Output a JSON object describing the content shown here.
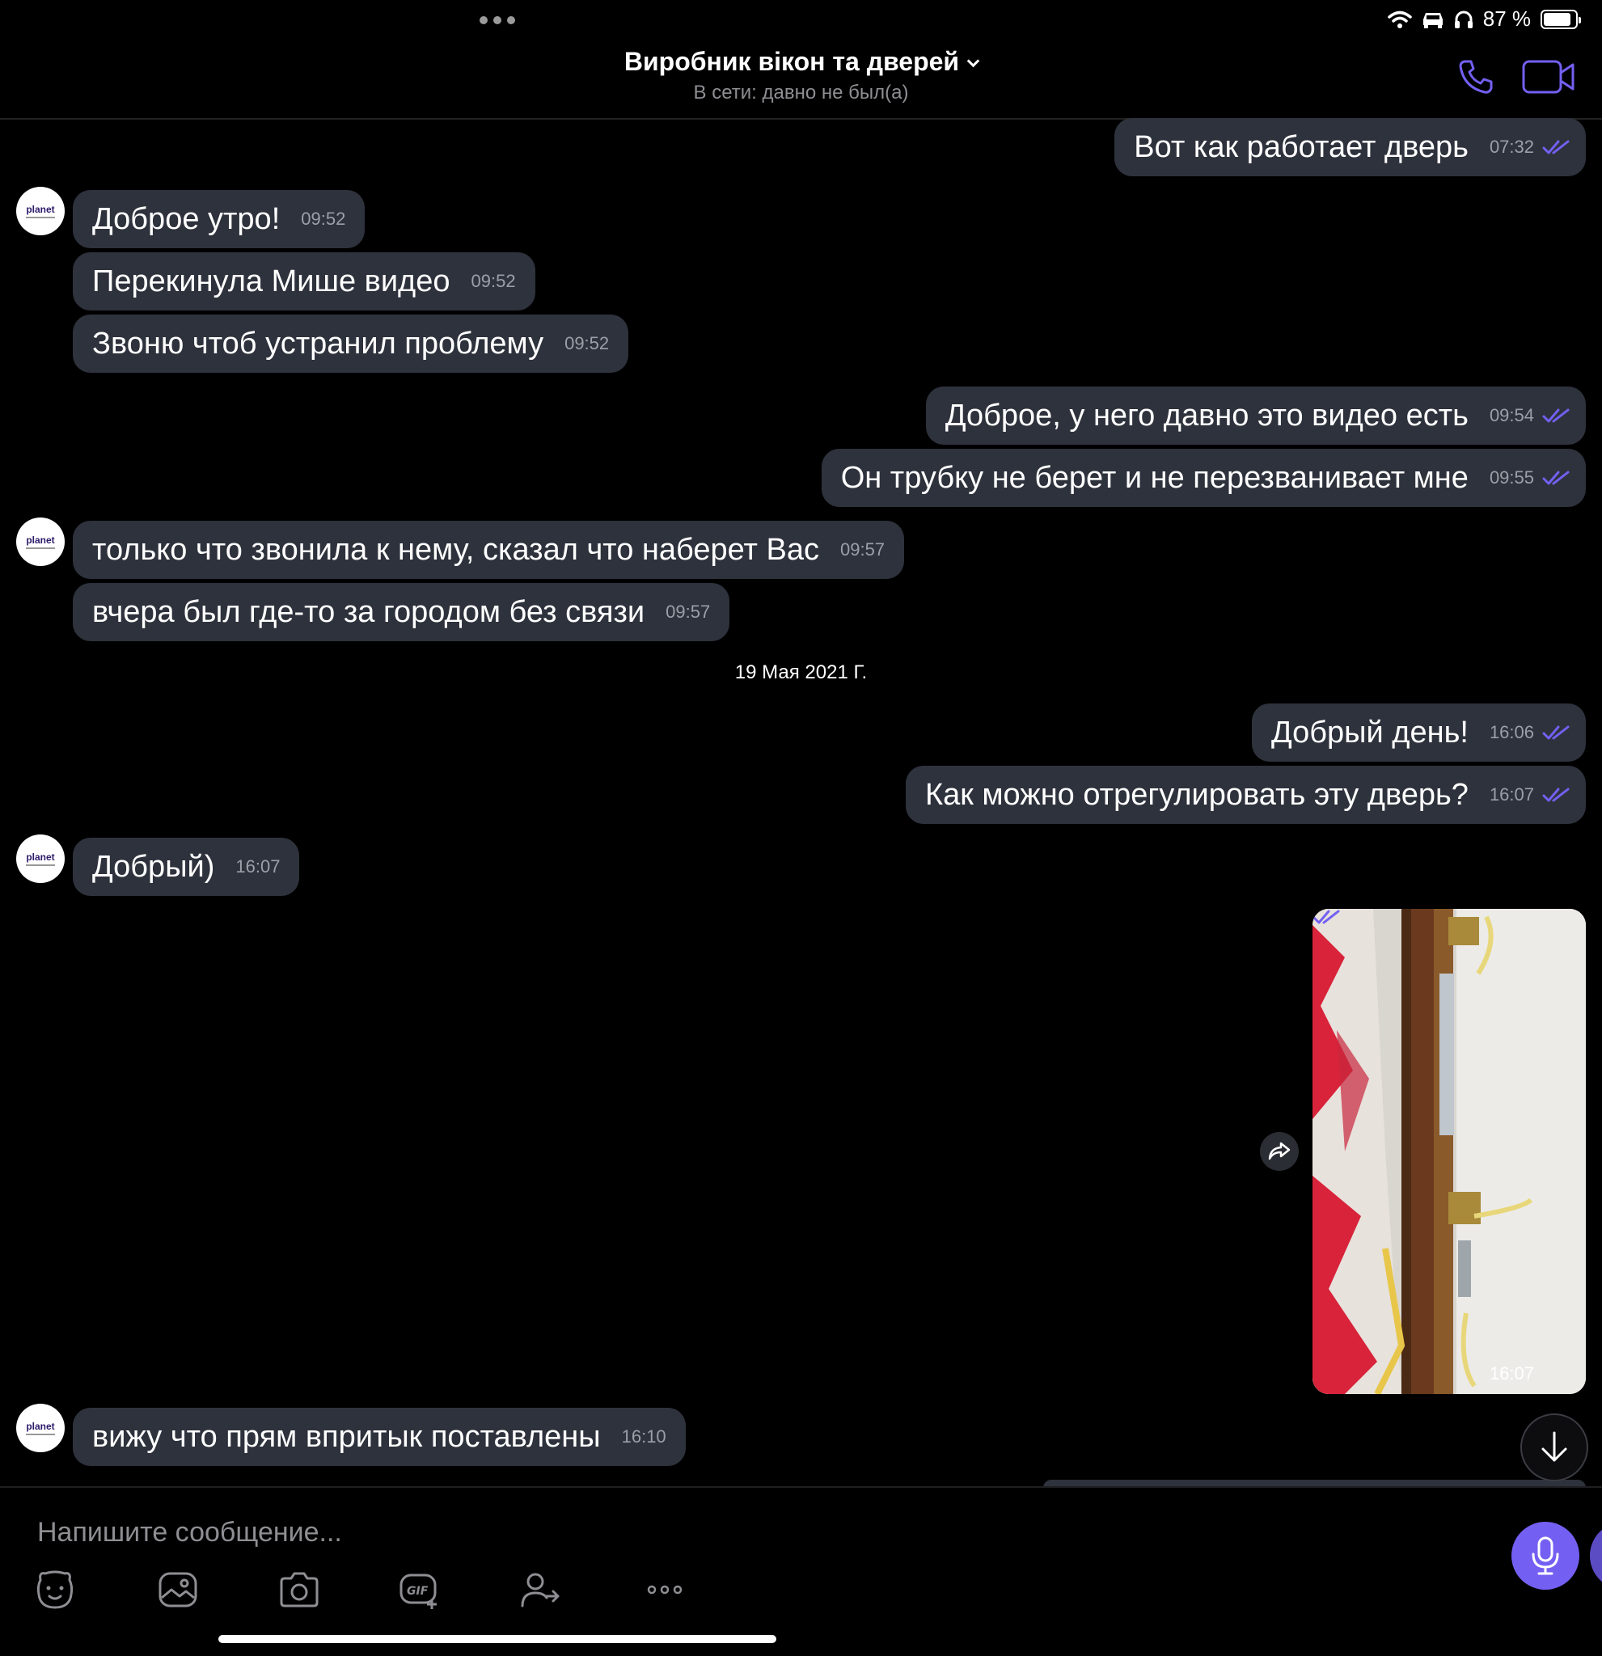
{
  "status": {
    "battery": "87 %",
    "battery_level": 0.87
  },
  "header": {
    "title": "Виробник вікон та дверей",
    "subtitle": "В сети: давно не был(а)"
  },
  "avatar": {
    "label": "planet"
  },
  "messages": [
    {
      "text": "Вот как работает дверь",
      "time": "07:32",
      "dir": "out"
    },
    {
      "text": "Доброе утро!",
      "time": "09:52",
      "dir": "in"
    },
    {
      "text": "Перекинула Мише видео",
      "time": "09:52",
      "dir": "in"
    },
    {
      "text": "Звоню чтоб устранил проблему",
      "time": "09:52",
      "dir": "in"
    },
    {
      "text": "Доброе, у него давно это видео есть",
      "time": "09:54",
      "dir": "out"
    },
    {
      "text": "Он трубку не берет и не перезванивает мне",
      "time": "09:55",
      "dir": "out"
    },
    {
      "text": "только что звонила к нему, сказал что наберет Вас",
      "time": "09:57",
      "dir": "in"
    },
    {
      "text": "вчера был где-то за городом без связи",
      "time": "09:57",
      "dir": "in"
    },
    {
      "text": "Добрый день!",
      "time": "16:06",
      "dir": "out"
    },
    {
      "text": "Как можно отрегулировать эту дверь?",
      "time": "16:07",
      "dir": "out"
    },
    {
      "text": "Добрый)",
      "time": "16:07",
      "dir": "in"
    },
    {
      "text": "вижу что прям впритык поставлены",
      "time": "16:10",
      "dir": "in"
    }
  ],
  "date_separator": "19 Мая 2021 Г.",
  "video_message": {
    "time": "16:07"
  },
  "composer": {
    "placeholder": "Напишите сообщение..."
  },
  "icons": {
    "call": "phone-icon",
    "video_call": "video-camera-icon",
    "tools": [
      "sticker-icon",
      "gallery-icon",
      "camera-icon",
      "gif-icon",
      "share-contact-icon",
      "more-icon"
    ],
    "mic": "microphone-icon"
  },
  "colors": {
    "accent": "#7360f2",
    "bubble": "#2e323c",
    "background": "#000000"
  }
}
